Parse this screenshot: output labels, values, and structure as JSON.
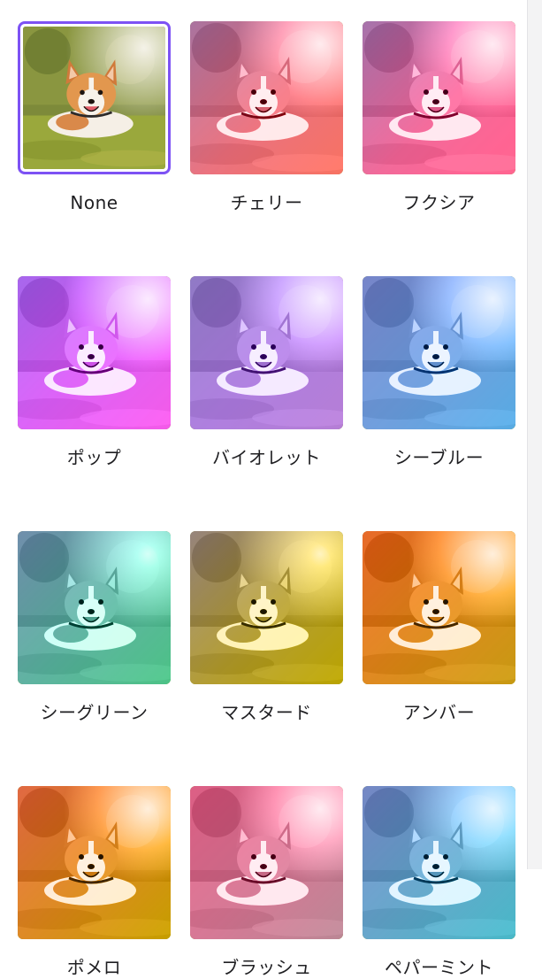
{
  "filters": [
    {
      "id": "none",
      "label": "None",
      "selected": true,
      "tint": null
    },
    {
      "id": "cherry",
      "label": "チェリー",
      "selected": false,
      "tint": "linear-gradient(135deg,#5a2450 0%,#b8404c 55%,#e05a4a 100%)"
    },
    {
      "id": "fuchsia",
      "label": "フクシア",
      "selected": false,
      "tint": "linear-gradient(135deg,#5a2860 0%,#c23a6a 55%,#ee4a78 100%)"
    },
    {
      "id": "pop",
      "label": "ポップ",
      "selected": false,
      "tint": "linear-gradient(135deg,#5a1aa0 0%,#a42cc0 50%,#e44ad8 100%)"
    },
    {
      "id": "violet",
      "label": "バイオレット",
      "selected": false,
      "tint": "linear-gradient(135deg,#3a2470 0%,#6a3a9a 55%,#9058b0 100%)"
    },
    {
      "id": "sea-blue",
      "label": "シーブルー",
      "selected": false,
      "tint": "linear-gradient(135deg,#1e2c70 0%,#2a5a98 55%,#3488c0 100%)"
    },
    {
      "id": "sea-green",
      "label": "シーグリーン",
      "selected": false,
      "tint": "linear-gradient(135deg,#1c3a58 0%,#1e7460 55%,#2aa064 100%)"
    },
    {
      "id": "mustard",
      "label": "マスタード",
      "selected": false,
      "tint": "linear-gradient(135deg,#4a3830 0%,#a08a20 55%,#e6d02c 100%)"
    },
    {
      "id": "amber",
      "label": "アンバー",
      "selected": false,
      "tint": "linear-gradient(135deg,#e86a2a 0%,#f2a034 55%,#f6c840 100%)"
    },
    {
      "id": "pomelo",
      "label": "ポメロ",
      "selected": false,
      "tint": "linear-gradient(135deg,#e8704a 0%,#f2a238 55%,#f8d030 100%)"
    },
    {
      "id": "blush",
      "label": "ブラッシュ",
      "selected": false,
      "tint": "linear-gradient(135deg,#e86a90 0%,#f094b0 55%,#f6c2d0 100%)"
    },
    {
      "id": "peppermint",
      "label": "ペパーミント",
      "selected": false,
      "tint": "linear-gradient(135deg,#384a88 0%,#4a8eb0 55%,#70e0f0 100%)"
    }
  ],
  "colors": {
    "selection_border": "#7d52f4",
    "label_text": "#1f1f22"
  }
}
